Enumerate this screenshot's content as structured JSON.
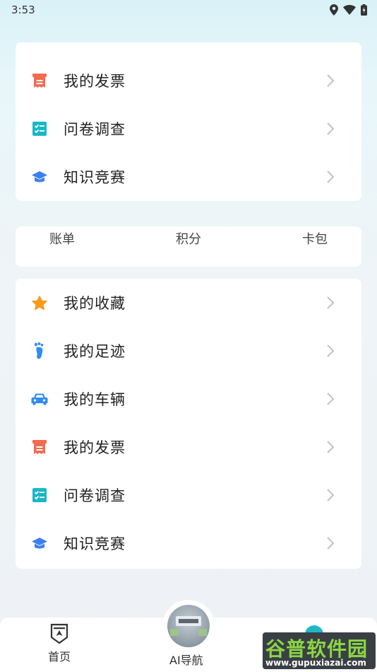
{
  "status_bar": {
    "time": "3:53"
  },
  "colors": {
    "invoice": "#f26b4f",
    "survey": "#18b8c6",
    "quiz": "#3c7ff0",
    "favorite": "#f79a1a",
    "footprint": "#2f8cf0",
    "vehicle": "#2f8cf0",
    "chevron": "#c2c2c2"
  },
  "top_menu": {
    "items": [
      {
        "label": "我的发票",
        "icon": "invoice-icon"
      },
      {
        "label": "问卷调查",
        "icon": "checklist-icon"
      },
      {
        "label": "知识竞赛",
        "icon": "graduation-cap-icon"
      }
    ]
  },
  "quick_links": [
    "账单",
    "积分",
    "卡包"
  ],
  "main_menu": {
    "items": [
      {
        "label": "我的收藏",
        "icon": "star-icon"
      },
      {
        "label": "我的足迹",
        "icon": "footprint-icon"
      },
      {
        "label": "我的车辆",
        "icon": "car-icon"
      },
      {
        "label": "我的发票",
        "icon": "invoice-icon"
      },
      {
        "label": "问卷调查",
        "icon": "checklist-icon"
      },
      {
        "label": "知识竞赛",
        "icon": "graduation-cap-icon"
      }
    ]
  },
  "bottom_nav": {
    "home": "首页",
    "ai_nav": "AI导航"
  },
  "watermark": {
    "title": "谷普软件园",
    "url": "www.gupuxiazai.com"
  }
}
